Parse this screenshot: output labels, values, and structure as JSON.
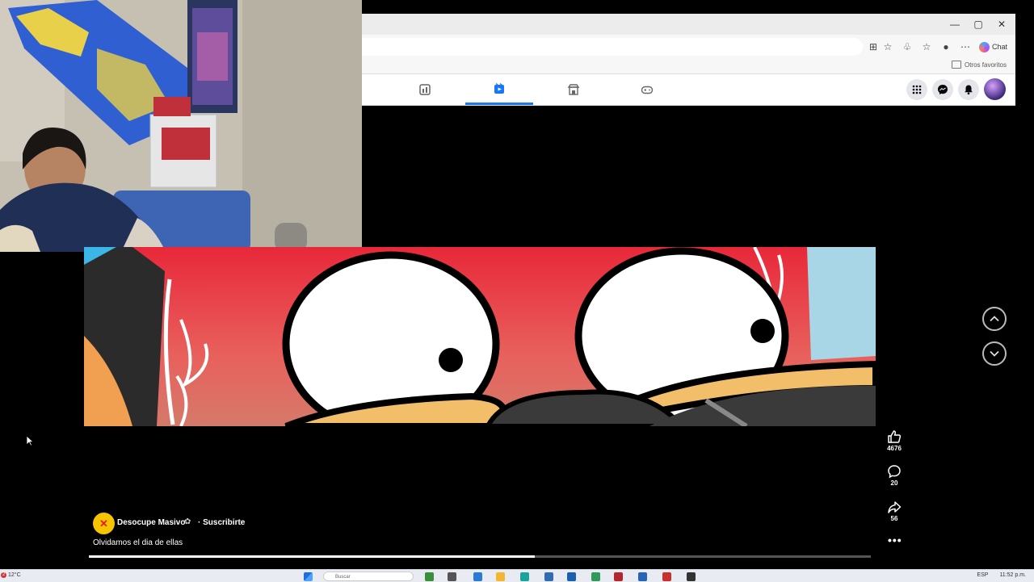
{
  "browser": {
    "window_controls": {
      "minimize": "—",
      "maximize": "▢",
      "close": "✕"
    },
    "chat_label": "Chat",
    "favorites_label": "Otros favoritos"
  },
  "facebook_nav": {
    "tabs": [
      {
        "name": "feeds",
        "icon": "feeds-icon",
        "active": false
      },
      {
        "name": "video",
        "icon": "video-icon",
        "active": true
      },
      {
        "name": "marketplace",
        "icon": "marketplace-icon",
        "active": false
      },
      {
        "name": "gaming",
        "icon": "gaming-icon",
        "active": false
      }
    ],
    "accent": "#1877f2"
  },
  "reel": {
    "channel_name": "Desocupe Masivo",
    "verified_glyph": "✿",
    "subscribe_label": "· Suscribirte",
    "caption": "Olvidamos el dia de ellas",
    "likes": "4676",
    "comments": "20",
    "shares": "56",
    "more": "•••",
    "progress": 0.57
  },
  "taskbar": {
    "weather_badge": "2",
    "temperature": "12°C",
    "search_placeholder": "Buscar",
    "language": "ESP",
    "clock": "11:52 p.m."
  }
}
